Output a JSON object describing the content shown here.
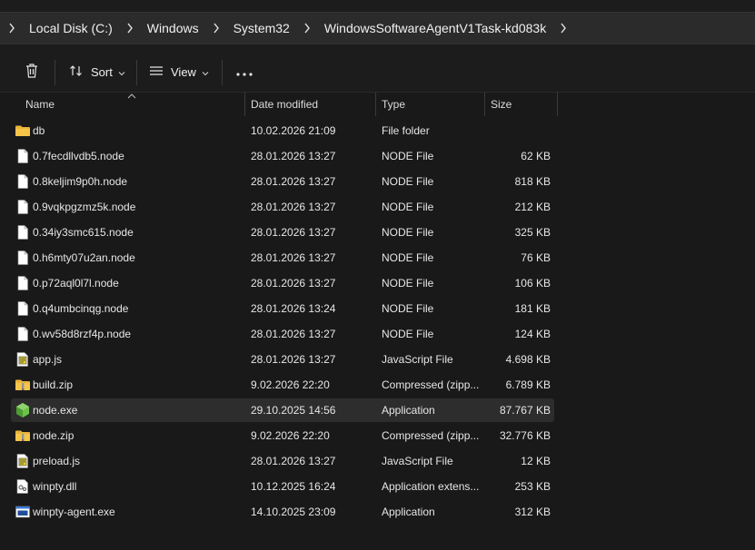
{
  "breadcrumb": {
    "items": [
      "Local Disk (C:)",
      "Windows",
      "System32",
      "WindowsSoftwareAgentV1Task-kd083k"
    ]
  },
  "toolbar": {
    "sort_label": "Sort",
    "view_label": "View"
  },
  "columns": {
    "name": "Name",
    "date": "Date modified",
    "type": "Type",
    "size": "Size"
  },
  "files": [
    {
      "name": "db",
      "date": "10.02.2026 21:09",
      "type": "File folder",
      "size": "",
      "icon": "folder-icon"
    },
    {
      "name": "0.7fecdllvdb5.node",
      "date": "28.01.2026 13:27",
      "type": "NODE File",
      "size": "62 KB",
      "icon": "file-icon"
    },
    {
      "name": "0.8keljim9p0h.node",
      "date": "28.01.2026 13:27",
      "type": "NODE File",
      "size": "818 KB",
      "icon": "file-icon"
    },
    {
      "name": "0.9vqkpgzmz5k.node",
      "date": "28.01.2026 13:27",
      "type": "NODE File",
      "size": "212 KB",
      "icon": "file-icon"
    },
    {
      "name": "0.34iy3smc615.node",
      "date": "28.01.2026 13:27",
      "type": "NODE File",
      "size": "325 KB",
      "icon": "file-icon"
    },
    {
      "name": "0.h6mty07u2an.node",
      "date": "28.01.2026 13:27",
      "type": "NODE File",
      "size": "76 KB",
      "icon": "file-icon"
    },
    {
      "name": "0.p72aql0l7l.node",
      "date": "28.01.2026 13:27",
      "type": "NODE File",
      "size": "106 KB",
      "icon": "file-icon"
    },
    {
      "name": "0.q4umbcinqg.node",
      "date": "28.01.2026 13:24",
      "type": "NODE File",
      "size": "181 KB",
      "icon": "file-icon"
    },
    {
      "name": "0.wv58d8rzf4p.node",
      "date": "28.01.2026 13:27",
      "type": "NODE File",
      "size": "124 KB",
      "icon": "file-icon"
    },
    {
      "name": "app.js",
      "date": "28.01.2026 13:27",
      "type": "JavaScript File",
      "size": "4.698 KB",
      "icon": "javascript-file-icon"
    },
    {
      "name": "build.zip",
      "date": "9.02.2026 22:20",
      "type": "Compressed (zipp...",
      "size": "6.789 KB",
      "icon": "zip-folder-icon"
    },
    {
      "name": "node.exe",
      "date": "29.10.2025 14:56",
      "type": "Application",
      "size": "87.767 KB",
      "icon": "nodejs-app-icon",
      "selected": true
    },
    {
      "name": "node.zip",
      "date": "9.02.2026 22:20",
      "type": "Compressed (zipp...",
      "size": "32.776 KB",
      "icon": "zip-folder-icon"
    },
    {
      "name": "preload.js",
      "date": "28.01.2026 13:27",
      "type": "JavaScript File",
      "size": "12 KB",
      "icon": "javascript-file-icon"
    },
    {
      "name": "winpty.dll",
      "date": "10.12.2025 16:24",
      "type": "Application extens...",
      "size": "253 KB",
      "icon": "dll-file-icon"
    },
    {
      "name": "winpty-agent.exe",
      "date": "14.10.2025 23:09",
      "type": "Application",
      "size": "312 KB",
      "icon": "app-window-icon"
    }
  ],
  "colors": {
    "background": "#191919",
    "selected_row": "#2d2d2d",
    "folder": "#f5c54a",
    "nodejs": "#6cc24a"
  }
}
